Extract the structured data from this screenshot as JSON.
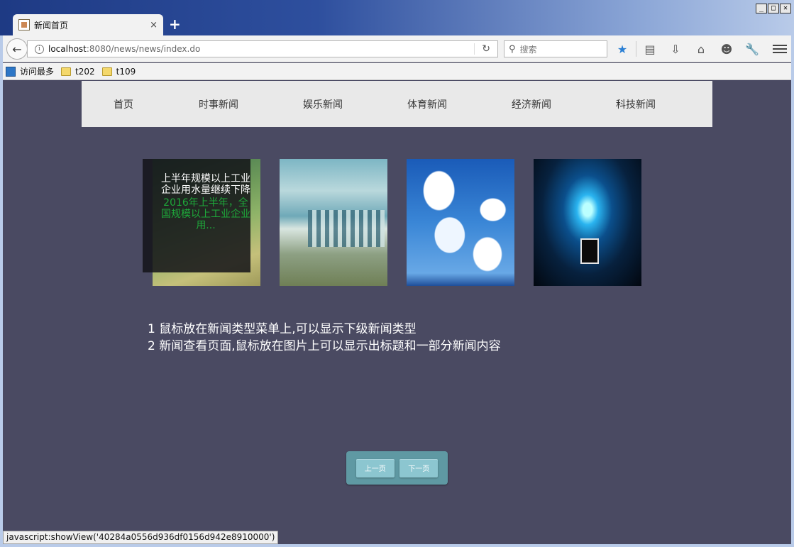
{
  "browser": {
    "window_controls": [
      "_",
      "□",
      "✕"
    ],
    "tab": {
      "title": "新闻首页",
      "close": "×"
    },
    "new_tab": "+",
    "url": {
      "host": "localhost",
      "path": ":8080/news/news/index.do"
    },
    "search_placeholder": "搜索",
    "bookmarks": [
      {
        "label": "访问最多",
        "icon": "most-visited-icon"
      },
      {
        "label": "t202",
        "icon": "folder-icon"
      },
      {
        "label": "t109",
        "icon": "folder-icon"
      }
    ],
    "status_text": "javascript:showView('40284a0556d936df0156d942e8910000')"
  },
  "site": {
    "nav": [
      "首页",
      "时事新闻",
      "娱乐新闻",
      "体育新闻",
      "经济新闻",
      "科技新闻"
    ],
    "overlay": {
      "title": "上半年规模以上工业企业用水量继续下降",
      "summary": "2016年上半年，全国规模以上工业企业用..."
    },
    "instructions": [
      "1 鼠标放在新闻类型菜单上,可以显示下级新闻类型",
      "2 新闻查看页面,鼠标放在图片上可以显示出标题和一部分新闻内容"
    ],
    "pager": {
      "prev": "上一页",
      "next": "下一页"
    }
  }
}
